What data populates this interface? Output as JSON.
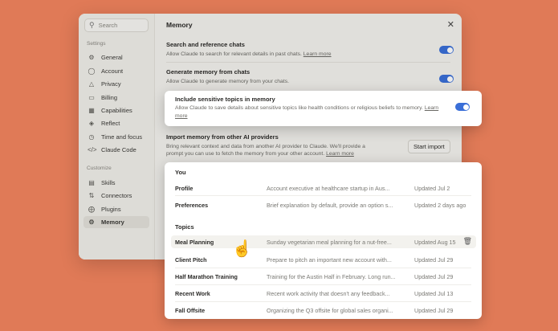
{
  "sidebar": {
    "search_placeholder": "Search",
    "settings_label": "Settings",
    "settings_items": [
      {
        "label": "General",
        "icon": "gear-icon"
      },
      {
        "label": "Account",
        "icon": "user-icon"
      },
      {
        "label": "Privacy",
        "icon": "shield-icon"
      },
      {
        "label": "Billing",
        "icon": "card-icon"
      },
      {
        "label": "Capabilities",
        "icon": "grid-icon"
      },
      {
        "label": "Reflect",
        "icon": "mirror-icon"
      },
      {
        "label": "Time and focus",
        "icon": "clock-icon"
      },
      {
        "label": "Claude Code",
        "icon": "code-icon"
      }
    ],
    "customize_label": "Customize",
    "customize_items": [
      {
        "label": "Skills",
        "icon": "skills-icon"
      },
      {
        "label": "Connectors",
        "icon": "plug-icon"
      },
      {
        "label": "Plugins",
        "icon": "puzzle-icon"
      },
      {
        "label": "Memory",
        "icon": "memory-icon",
        "active": true
      }
    ]
  },
  "main": {
    "title": "Memory",
    "settings": [
      {
        "title": "Search and reference chats",
        "desc": "Allow Claude to search for relevant details in past chats.",
        "link": "Learn more",
        "on": true
      },
      {
        "title": "Generate memory from chats",
        "desc": "Allow Claude to generate memory from your chats.",
        "link": "",
        "on": true
      }
    ],
    "sensitive": {
      "title": "Include sensitive topics in memory",
      "desc": "Allow Claude to save details about sensitive topics like health conditions or religious beliefs to memory.",
      "link": "Learn more",
      "on": true
    },
    "import": {
      "title": "Import memory from other AI providers",
      "desc": "Bring relevant context and data from another AI provider to Claude. We'll provide a prompt you can use to fetch the memory from your other account.",
      "link": "Learn more",
      "button": "Start import"
    }
  },
  "memory_table": {
    "you_label": "You",
    "you_rows": [
      {
        "name": "Profile",
        "summary": "Account executive  at healthcare startup in Aus...",
        "updated": "Updated Jul 2"
      },
      {
        "name": "Preferences",
        "summary": "Brief explanation by default, provide an option s...",
        "updated": "Updated 2 days ago"
      }
    ],
    "topics_label": "Topics",
    "topic_rows": [
      {
        "name": "Meal Planning",
        "summary": "Sunday vegetarian meal planning for a nut-free...",
        "updated": "Updated Aug 15"
      },
      {
        "name": "Client Pitch",
        "summary": "Prepare to pitch an important new account with...",
        "updated": "Updated Jul 29"
      },
      {
        "name": "Half Marathon Training",
        "summary": "Training for the Austin Half in February. Long run...",
        "updated": "Updated Jul 29"
      },
      {
        "name": "Recent Work",
        "summary": "Recent work activity that doesn't any feedback...",
        "updated": "Updated Jul 13"
      },
      {
        "name": "Fall Offsite",
        "summary": "Organizing the Q3 offsite for global sales organi...",
        "updated": "Updated Jul 29"
      }
    ]
  }
}
